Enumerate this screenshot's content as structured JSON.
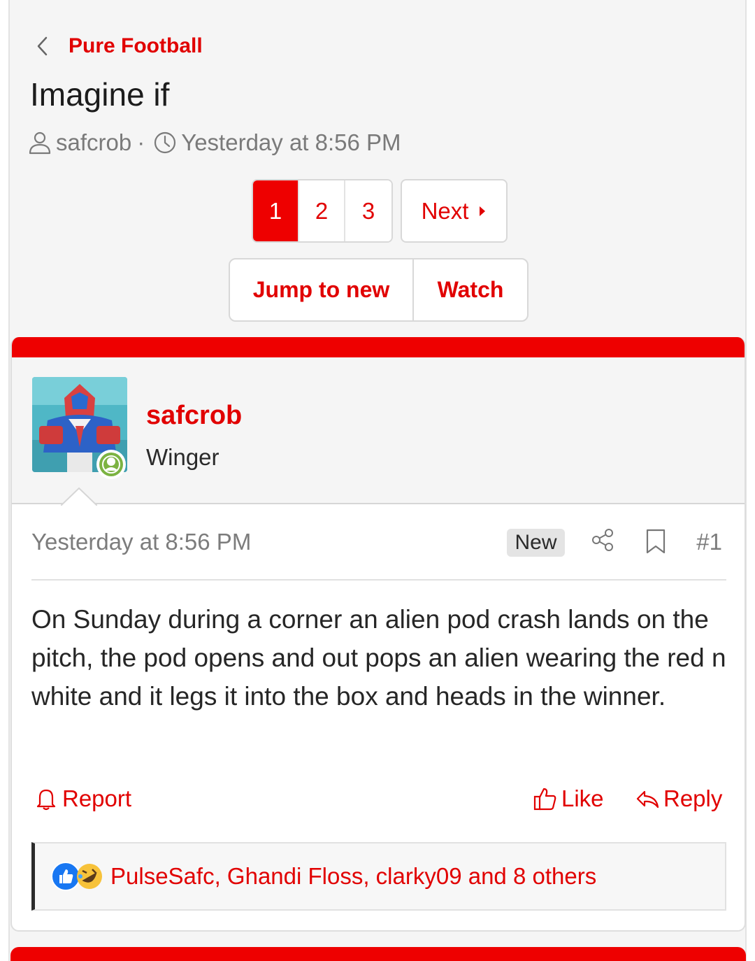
{
  "breadcrumb": {
    "label": "Pure Football"
  },
  "thread": {
    "title": "Imagine if",
    "author": "safcrob",
    "separator": "·",
    "date": "Yesterday at 8:56 PM"
  },
  "pagination": {
    "pages": [
      "1",
      "2",
      "3"
    ],
    "current": "1",
    "next_label": "Next"
  },
  "actions": {
    "jump_label": "Jump to new",
    "watch_label": "Watch"
  },
  "post": {
    "author": "safcrob",
    "user_title": "Winger",
    "time": "Yesterday at 8:56 PM",
    "badge": "New",
    "number": "#1",
    "body": "On Sunday during a corner an alien pod crash lands on the pitch, the pod opens and out pops an alien wearing the red n white and it legs it into the box and heads in the winner.",
    "report_label": "Report",
    "like_label": "Like",
    "reply_label": "Reply",
    "reactions_text": "PulseSafc, Ghandi Floss, clarky09 and 8 others"
  },
  "colors": {
    "accent": "#e10000",
    "bar": "#ee0000",
    "online": "#7cb342"
  },
  "icons": {
    "back": "chevron-left-icon",
    "user": "user-icon",
    "clock": "clock-icon",
    "share": "share-icon",
    "bookmark": "bookmark-icon",
    "report": "bell-icon",
    "like": "thumbs-up-icon",
    "reply": "reply-icon"
  }
}
